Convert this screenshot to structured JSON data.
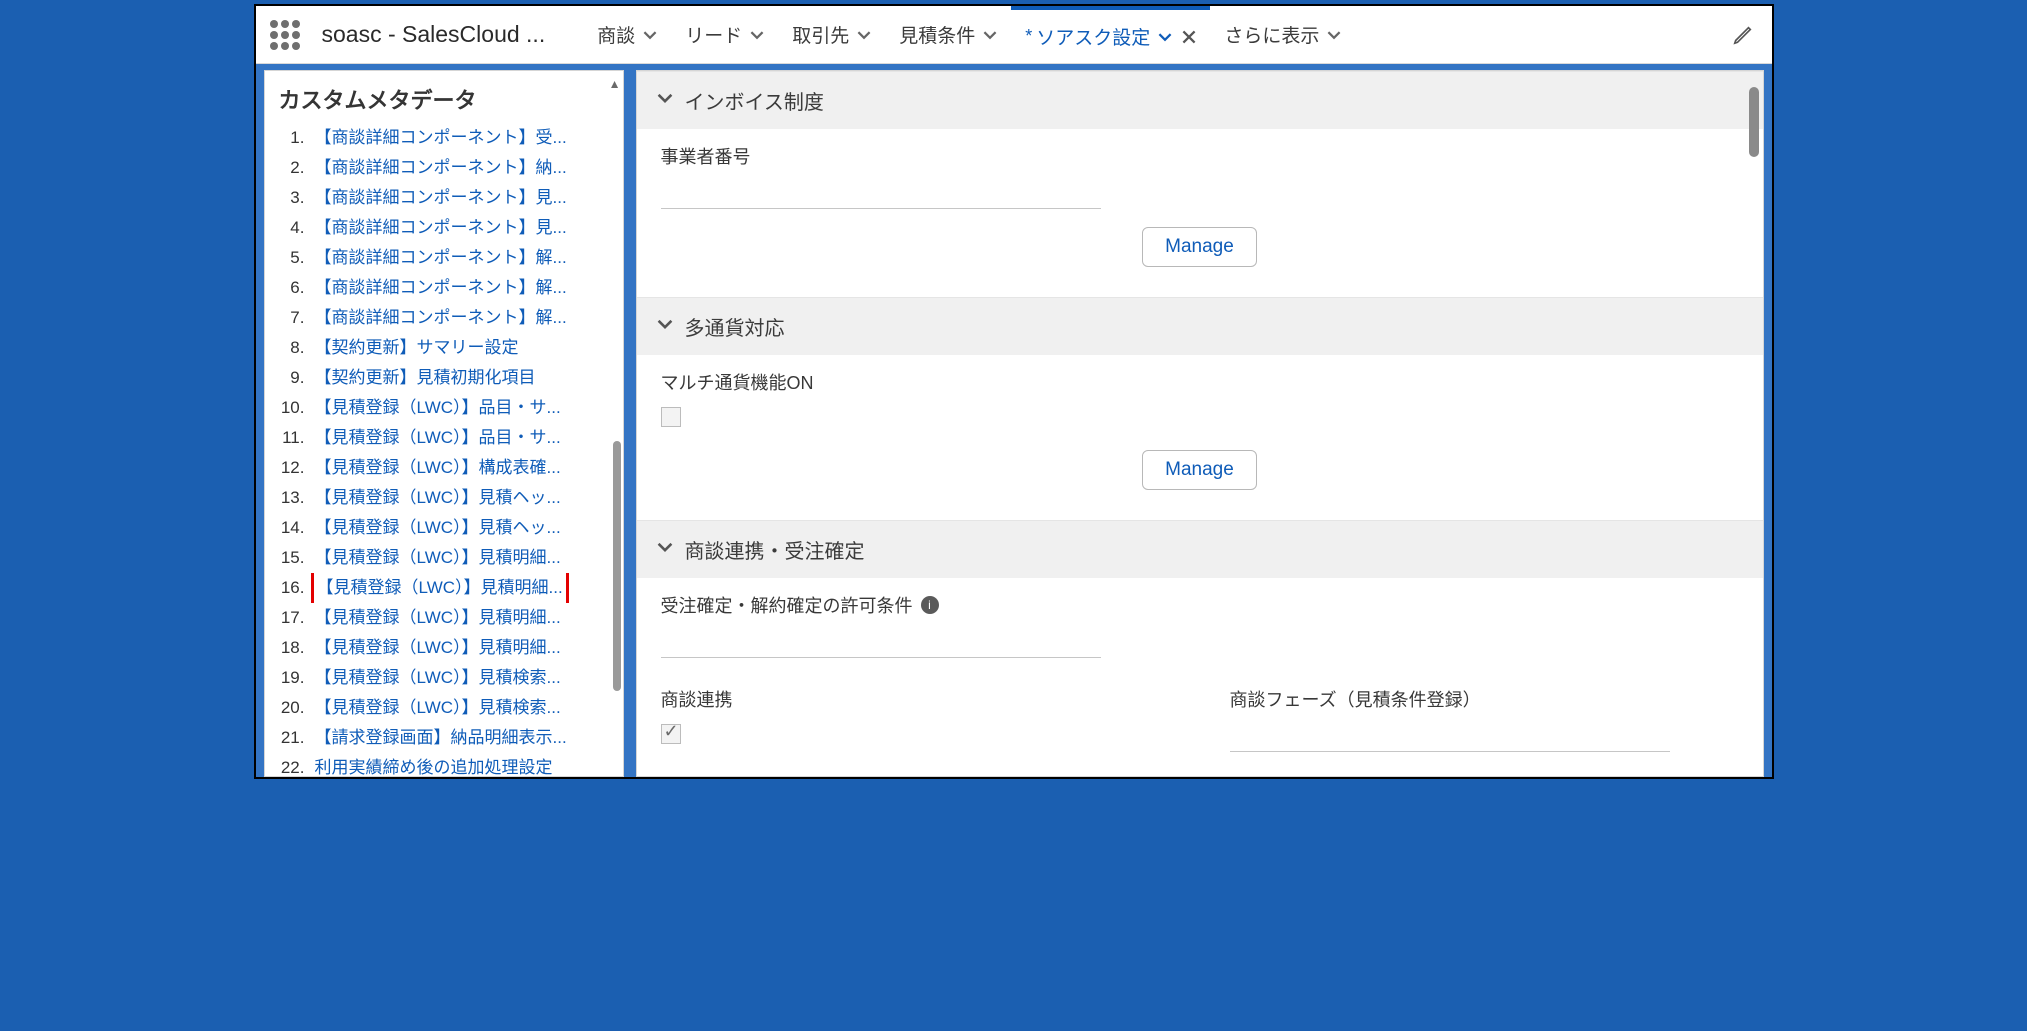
{
  "header": {
    "app_title": "soasc - SalesCloud ...",
    "tabs": [
      {
        "label": "商談"
      },
      {
        "label": "リード"
      },
      {
        "label": "取引先"
      },
      {
        "label": "見積条件"
      },
      {
        "label": "ソアスク設定",
        "active": true,
        "dirty": true,
        "closable": true
      },
      {
        "label": "さらに表示"
      }
    ]
  },
  "sidebar": {
    "title": "カスタムメタデータ",
    "items": [
      "【商談詳細コンポーネント】受...",
      "【商談詳細コンポーネント】納...",
      "【商談詳細コンポーネント】見...",
      "【商談詳細コンポーネント】見...",
      "【商談詳細コンポーネント】解...",
      "【商談詳細コンポーネント】解...",
      "【商談詳細コンポーネント】解...",
      "【契約更新】サマリー設定",
      "【契約更新】見積初期化項目",
      "【見積登録（LWC）】品目・サ...",
      "【見積登録（LWC）】品目・サ...",
      "【見積登録（LWC）】構成表確...",
      "【見積登録（LWC）】見積ヘッ...",
      "【見積登録（LWC）】見積ヘッ...",
      "【見積登録（LWC）】見積明細...",
      "【見積登録（LWC）】見積明細...",
      "【見積登録（LWC）】見積明細...",
      "【見積登録（LWC）】見積明細...",
      "【見積登録（LWC）】見積検索...",
      "【見積登録（LWC）】見積検索...",
      "【請求登録画面】納品明細表示...",
      "利用実績締め後の追加処理設定"
    ],
    "highlight_index": 15
  },
  "main": {
    "sections": {
      "invoice": {
        "title": "インボイス制度",
        "field1_label": "事業者番号",
        "manage_label": "Manage"
      },
      "currency": {
        "title": "多通貨対応",
        "field1_label": "マルチ通貨機能ON",
        "manage_label": "Manage"
      },
      "oppty": {
        "title": "商談連携・受注確定",
        "perm_label": "受注確定・解約確定の許可条件",
        "link_label": "商談連携",
        "phase_label": "商談フェーズ（見積条件登録）"
      }
    }
  }
}
